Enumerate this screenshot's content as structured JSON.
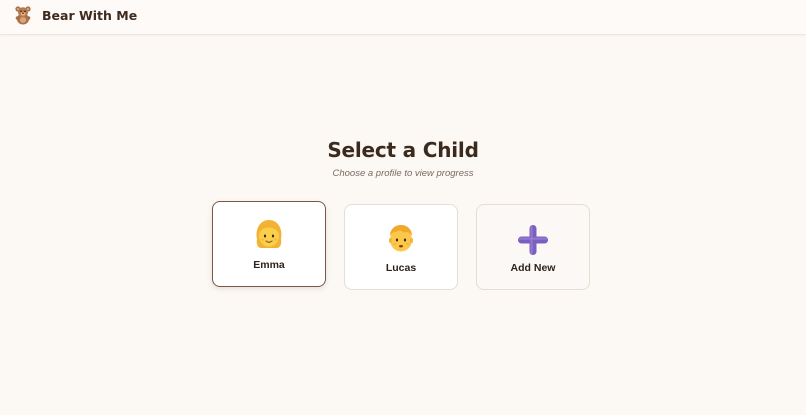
{
  "header": {
    "app_title": "Bear With Me",
    "logo_icon": "teddy-bear-icon"
  },
  "main": {
    "title": "Select a Child",
    "subtitle": "Choose a profile to view progress"
  },
  "profiles": [
    {
      "name": "Emma",
      "icon": "girl-avatar-icon",
      "selected": true
    },
    {
      "name": "Lucas",
      "icon": "boy-avatar-icon",
      "selected": false
    }
  ],
  "add_new": {
    "label": "Add New",
    "icon": "plus-icon"
  },
  "colors": {
    "background": "#fcf8f4",
    "selected_border": "#7a5648",
    "plus_accent": "#7b5fc0"
  }
}
